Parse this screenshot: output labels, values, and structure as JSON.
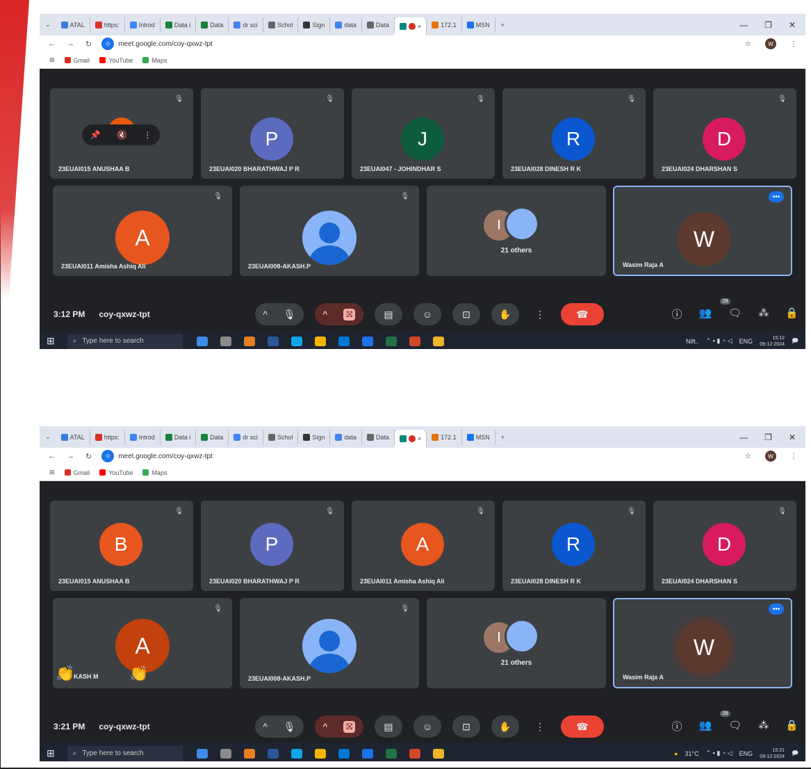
{
  "browser": {
    "tabs": [
      {
        "label": "ATAL",
        "color": "#3b7ddd"
      },
      {
        "label": "https:",
        "color": "#d93025"
      },
      {
        "label": "Introd",
        "color": "#4285f4"
      },
      {
        "label": "Data i",
        "color": "#188038"
      },
      {
        "label": "Data",
        "color": "#188038"
      },
      {
        "label": "dr sci",
        "color": "#4285f4"
      },
      {
        "label": "Schol",
        "color": "#666666"
      },
      {
        "label": "Sign",
        "color": "#333333"
      },
      {
        "label": "data",
        "color": "#4285f4"
      },
      {
        "label": "Data",
        "color": "#666666"
      },
      {
        "label": "172.1",
        "color": "#e8710a"
      },
      {
        "label": "MSN",
        "color": "#1a73e8"
      }
    ],
    "active_tab_close": "×",
    "new_tab": "+",
    "window_controls": [
      "—",
      "❐",
      "✕"
    ],
    "url": "meet.google.com/coy-qxwz-tpt",
    "profile_initial": "W",
    "bookmarks": [
      {
        "label": "Gmail",
        "color": "#d93025"
      },
      {
        "label": "YouTube",
        "color": "#ff0000"
      },
      {
        "label": "Maps",
        "color": "#34a853"
      }
    ]
  },
  "screenshots": [
    {
      "top_row": [
        {
          "name": "23EUAI015 ANUSHAA B",
          "initial": "",
          "color": "#e8590c",
          "hover": true
        },
        {
          "name": "23EUAI020 BHARATHWAJ P R",
          "initial": "P",
          "color": "#5c6bc0"
        },
        {
          "name": "23EUAI047 - JOHINDHAR S",
          "initial": "J",
          "color": "#0d5c3e"
        },
        {
          "name": "23EUAI028 DINESH R K",
          "initial": "R",
          "color": "#0b57d0"
        },
        {
          "name": "23EUAI024 DHARSHAN S",
          "initial": "D",
          "color": "#d81b60"
        }
      ],
      "bottom_row": [
        {
          "name": "23EUAI011 Amisha Ashiq Ali",
          "initial": "A",
          "color": "#e8561f"
        },
        {
          "name": "23EUAI008-AKASH.P",
          "initial": "",
          "color": "#8ab4f8"
        },
        {
          "others_initial": "I",
          "others_text": "21 others"
        },
        {
          "name": "Wasim Raja A",
          "initial": "W",
          "color": "#5d3a2e",
          "more": "•••"
        }
      ],
      "meeting_time": "3:12 PM",
      "meeting_code": "coy-qxwz-tpt",
      "participants_badge": "29",
      "taskbar": {
        "search_placeholder": "Type here to search",
        "weather": "Nift..",
        "lang": "ENG",
        "time": "15:12",
        "date": "09-12-2024"
      }
    },
    {
      "top_row": [
        {
          "name": "23EUAI015 ANUSHAA B",
          "initial": "B",
          "color": "#e8561f"
        },
        {
          "name": "23EUAI020 BHARATHWAJ P R",
          "initial": "P",
          "color": "#5c6bc0"
        },
        {
          "name": "23EUAI011 Amisha Ashiq Ali",
          "initial": "A",
          "color": "#e8561f"
        },
        {
          "name": "23EUAI028 DINESH R K",
          "initial": "R",
          "color": "#0b57d0"
        },
        {
          "name": "23EUAI024 DHARSHAN S",
          "initial": "D",
          "color": "#d81b60"
        }
      ],
      "bottom_row": [
        {
          "name": "KASH M",
          "initial": "A",
          "color": "#c2410c",
          "reactions": [
            "👏",
            "👏"
          ]
        },
        {
          "name": "23EUAI008-AKASH.P",
          "initial": "",
          "color": "#8ab4f8"
        },
        {
          "others_initial": "I",
          "others_text": "21 others"
        },
        {
          "name": "Wasim Raja A",
          "initial": "W",
          "color": "#5d3a2e",
          "more": "•••"
        }
      ],
      "meeting_time": "3:21 PM",
      "meeting_code": "coy-qxwz-tpt",
      "participants_badge": "29",
      "taskbar": {
        "search_placeholder": "Type here to search",
        "weather": "31°C",
        "lang": "ENG",
        "time": "15:21",
        "date": "09-12-2024"
      }
    }
  ],
  "icons": {
    "mic_off": "🎤̸",
    "mic": "🎙",
    "chevron_up": "^",
    "camera_off": "⛝",
    "captions": "▤",
    "emoji": "☺",
    "present": "⊡",
    "hand": "✋",
    "more_vert": "⋮",
    "hangup": "☎",
    "info": "ⓘ",
    "people": "👥",
    "chat": "🗨",
    "activities": "⁂",
    "lock": "🔒",
    "pin": "📌",
    "windows": "⊞",
    "search": "⌕"
  }
}
